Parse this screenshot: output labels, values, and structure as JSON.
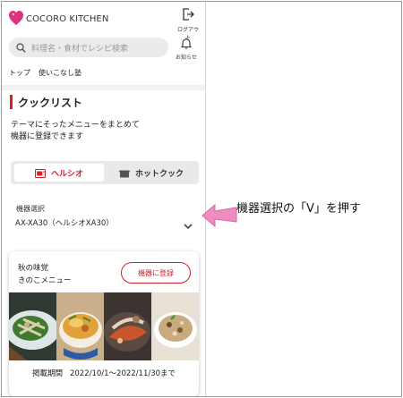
{
  "header": {
    "brand": "COCORO KITCHEN",
    "logout_label": "ログアウト",
    "search_placeholder": "料理名・食材でレシピ検索",
    "notify_label": "お知らせ",
    "nav": [
      "トップ",
      "使いこなし塾"
    ]
  },
  "main": {
    "title": "クックリスト",
    "description_line1": "テーマにそったメニューをまとめて",
    "description_line2": "機器に登録できます",
    "tabs": [
      {
        "label": "ヘルシオ",
        "active": true
      },
      {
        "label": "ホットクック",
        "active": false
      }
    ],
    "device_label": "機器選択",
    "device_value": "AX-XA30（ヘルシオXA30）"
  },
  "card": {
    "line1": "秋の味覚",
    "line2": "きのこメニュー",
    "register_label": "機器に登録",
    "period_label": "掲載期間",
    "period_value": "2022/10/1～2022/11/30まで"
  },
  "annotation": {
    "text": "機器選択の「V」を押す",
    "color": "#f08cc0"
  },
  "colors": {
    "accent": "#d71f2a",
    "brand_pink": "#e0317e"
  }
}
